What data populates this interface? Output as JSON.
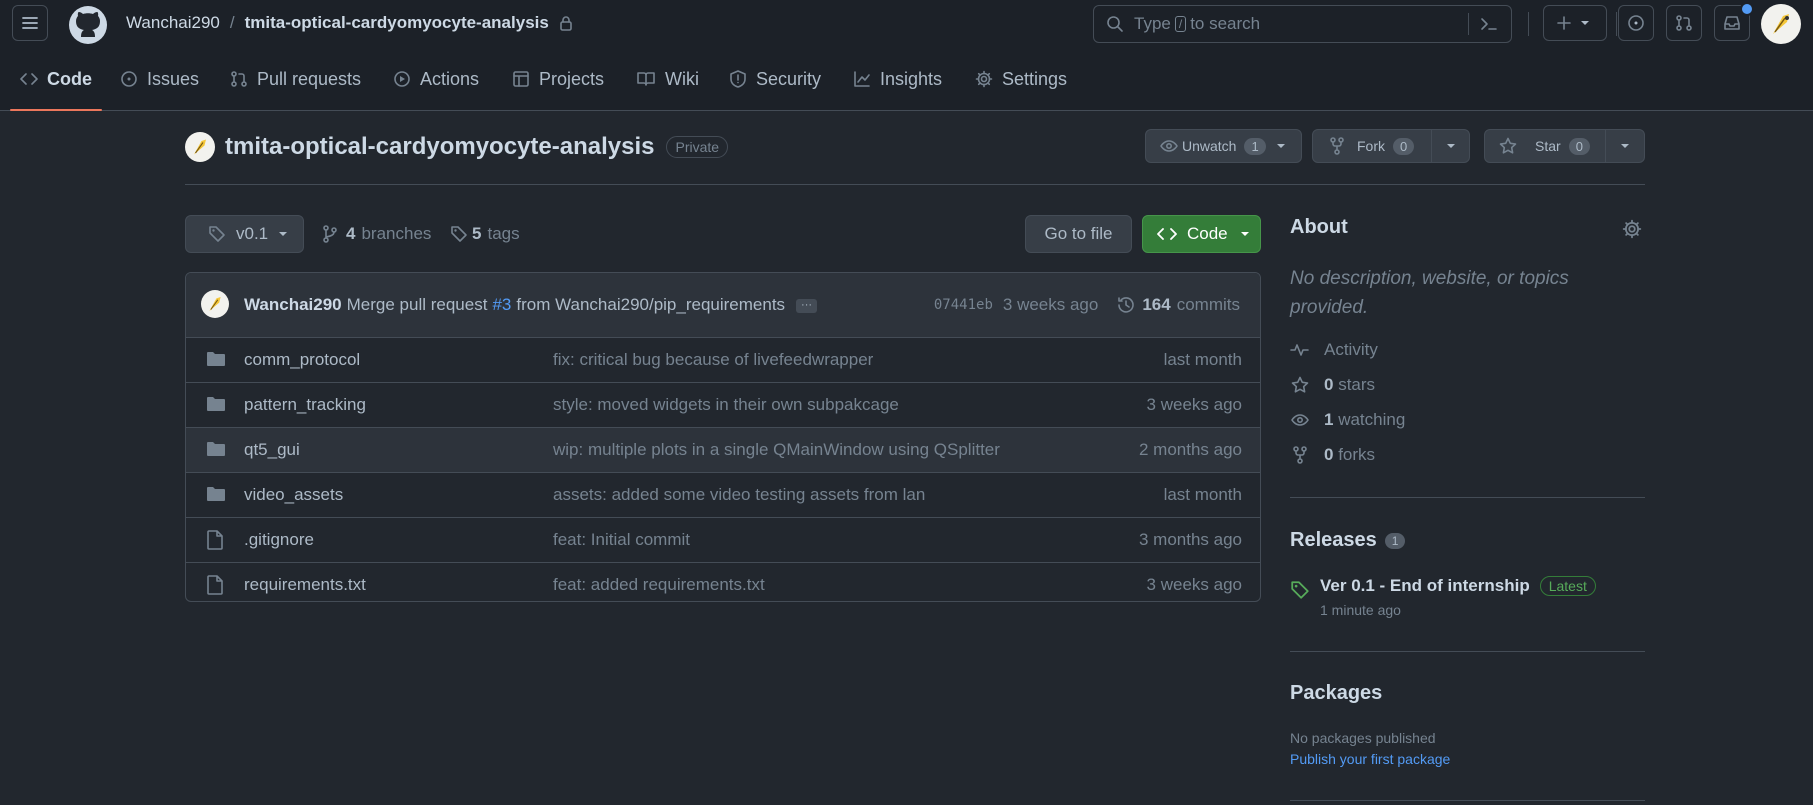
{
  "top": {
    "owner": "Wanchai290",
    "separator": "/",
    "repo": "tmita-optical-cardyomyocyte-analysis",
    "search_prefix": "Type",
    "search_key": "/",
    "search_suffix": "to search"
  },
  "tabs": [
    {
      "label": "Code",
      "icon": "code-icon"
    },
    {
      "label": "Issues",
      "icon": "issue-icon"
    },
    {
      "label": "Pull requests",
      "icon": "pull-request-icon"
    },
    {
      "label": "Actions",
      "icon": "play-icon"
    },
    {
      "label": "Projects",
      "icon": "table-icon"
    },
    {
      "label": "Wiki",
      "icon": "book-icon"
    },
    {
      "label": "Security",
      "icon": "shield-icon"
    },
    {
      "label": "Insights",
      "icon": "graph-icon"
    },
    {
      "label": "Settings",
      "icon": "gear-icon"
    }
  ],
  "header": {
    "repo_title": "tmita-optical-cardyomyocyte-analysis",
    "visibility": "Private",
    "unwatch_label": "Unwatch",
    "unwatch_count": "1",
    "fork_label": "Fork",
    "fork_count": "0",
    "star_label": "Star",
    "star_count": "0"
  },
  "bar": {
    "branch": "v0.1",
    "branches_count": "4",
    "branches_label": "branches",
    "tags_count": "5",
    "tags_label": "tags",
    "go_to_file": "Go to file",
    "code_label": "Code"
  },
  "commit": {
    "author": "Wanchai290",
    "msg_prefix": "Merge pull request",
    "pr": "#3",
    "msg_suffix": "from Wanchai290/pip_requirements",
    "ellipsis": "···",
    "sha": "07441eb",
    "age": "3 weeks ago",
    "count": "164",
    "count_label": "commits"
  },
  "files": [
    {
      "type": "folder",
      "name": "comm_protocol",
      "message": "fix: critical bug because of livefeedwrapper",
      "age": "last month"
    },
    {
      "type": "folder",
      "name": "pattern_tracking",
      "message": "style: moved widgets in their own subpakcage",
      "age": "3 weeks ago"
    },
    {
      "type": "folder",
      "name": "qt5_gui",
      "message": "wip: multiple plots in a single QMainWindow using QSplitter",
      "age": "2 months ago"
    },
    {
      "type": "folder",
      "name": "video_assets",
      "message": "assets: added some video testing assets from lan",
      "age": "last month"
    },
    {
      "type": "file",
      "name": ".gitignore",
      "message": "feat: Initial commit",
      "age": "3 months ago"
    },
    {
      "type": "file",
      "name": "requirements.txt",
      "message": "feat: added requirements.txt",
      "age": "3 weeks ago"
    }
  ],
  "about": {
    "title": "About",
    "description": "No description, website, or topics provided.",
    "activity": "Activity",
    "stars_count": "0",
    "stars_label": "stars",
    "watching_count": "1",
    "watching_label": "watching",
    "forks_count": "0",
    "forks_label": "forks"
  },
  "releases": {
    "title": "Releases",
    "count": "1",
    "name": "Ver 0.1 - End of internship",
    "badge": "Latest",
    "time": "1 minute ago"
  },
  "packages": {
    "title": "Packages",
    "none": "No packages published",
    "publish": "Publish your first package"
  },
  "colors": {
    "bg": "#22272e",
    "header_bg": "#1c2128",
    "accent_green": "#347d39",
    "tab_underline": "#ec775c",
    "link": "#539bf5"
  }
}
